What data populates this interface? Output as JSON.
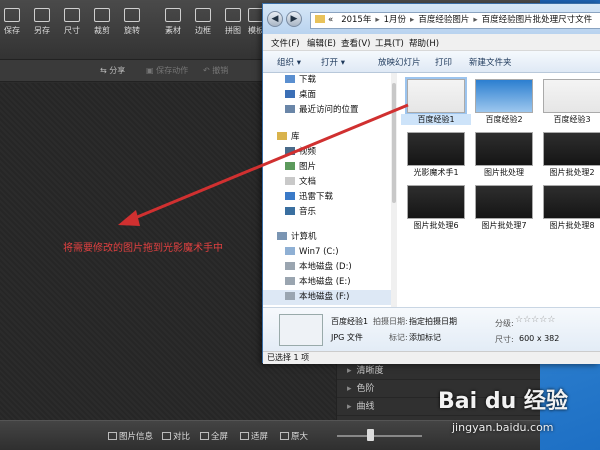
{
  "app": {
    "toolbar": [
      {
        "label": "保存",
        "icon": "save-icon"
      },
      {
        "label": "另存",
        "icon": "save-as-icon"
      },
      {
        "label": "尺寸",
        "icon": "resize-icon"
      },
      {
        "label": "裁剪",
        "icon": "crop-icon"
      },
      {
        "label": "旋转",
        "icon": "rotate-icon"
      },
      {
        "label": "素材",
        "icon": "material-icon"
      },
      {
        "label": "边框",
        "icon": "border-icon"
      },
      {
        "label": "拼图",
        "icon": "collage-icon"
      },
      {
        "label": "模板",
        "icon": "template-icon"
      }
    ],
    "subbar": {
      "share": "分享",
      "save_action": "保存动作",
      "undo": "撤销"
    },
    "hint": "将需要修改的图片拖到光影魔术手中",
    "panel": [
      "清晰度",
      "色阶",
      "曲线"
    ],
    "bottom": {
      "info": "图片信息",
      "compare": "对比",
      "fullscreen": "全屏",
      "fit": "适屏",
      "original": "原大"
    }
  },
  "explorer": {
    "address": [
      "«",
      "2015年",
      "1月份",
      "百度经验图片",
      "百度经验图片批处理尺寸文件"
    ],
    "menu": [
      "文件(F)",
      "编辑(E)",
      "查看(V)",
      "工具(T)",
      "帮助(H)"
    ],
    "commands": [
      "组织 ▾",
      "打开 ▾",
      "放映幻灯片",
      "打印",
      "新建文件夹"
    ],
    "nav": [
      "下载",
      "桌面",
      "最近访问的位置",
      "库",
      "视频",
      "图片",
      "文档",
      "迅雷下载",
      "音乐",
      "计算机",
      "Win7 (C:)",
      "本地磁盘 (D:)",
      "本地磁盘 (E:)",
      "本地磁盘 (F:)"
    ],
    "files": [
      "百度经验1",
      "百度经验2",
      "百度经验3",
      "光影魔术手1",
      "图片批处理",
      "图片批处理2",
      "图片批处理6",
      "图片批处理7",
      "图片批处理8"
    ],
    "details": {
      "name": "百度经验1",
      "type": "JPG 文件",
      "date_label": "拍摄日期:",
      "date_value": "指定拍摄日期",
      "tags_label": "标记:",
      "tags_value": "添加标记",
      "rating_label": "分级:",
      "size_label": "尺寸:",
      "size_value": "600 x 382"
    },
    "status": "已选择 1 项"
  },
  "watermark": {
    "logo": "Bai du 经验",
    "url": "jingyan.baidu.com"
  },
  "colors": {
    "hint": "#e04040",
    "arrow": "#d03030",
    "selection": "#cde3f9"
  }
}
